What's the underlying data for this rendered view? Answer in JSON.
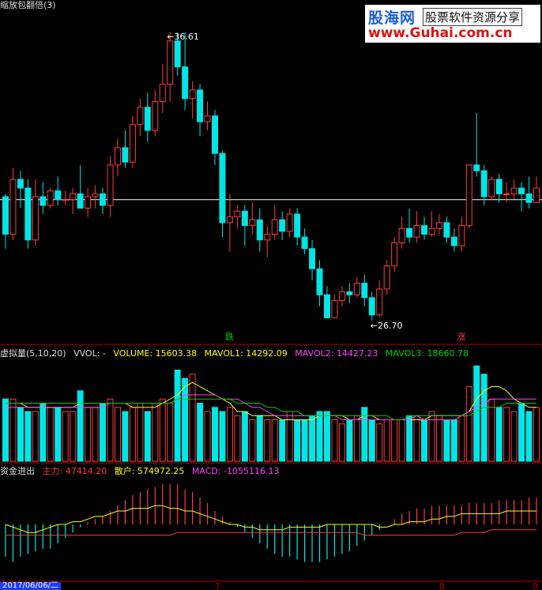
{
  "header": {
    "title": "缩放包翻倍(3)"
  },
  "logo": {
    "name": "股海网",
    "tagline": "股票软件资源分享",
    "url": "www.Guhai.com.cn"
  },
  "colors": {
    "up": "#ff3b3b",
    "down": "#00e5e5",
    "white": "#ffffff",
    "yellow": "#ffff00",
    "magenta": "#ff40ff",
    "green": "#00d000"
  },
  "price_panel": {
    "high_label": "36.61",
    "low_label": "26.70",
    "signals": [
      {
        "text": "跌",
        "color": "#00d000"
      },
      {
        "text": "涨",
        "color": "#ff3b3b"
      }
    ],
    "ref_price": 30.8
  },
  "volume_panel": {
    "name": "虚拟量(5,10,20)",
    "vvol": "VVOL: -",
    "volume": "VOLUME: 15603.38",
    "mavol1": "MAVOL1: 14292.09",
    "mavol2": "MAVOL2: 14427.23",
    "mavol3": "MAVOL3: 18660.78"
  },
  "fund_panel": {
    "name": "资金进出",
    "main": "主力: 47414.20",
    "retail": "散户: 574972.25",
    "macd": "MACD: -1055116.13"
  },
  "date_axis": {
    "first_date": "2017/06/06/二",
    "ticks": [
      "7",
      "8",
      "9"
    ]
  },
  "chart_data": {
    "type": "candlestick",
    "price_range": [
      26.0,
      37.5
    ],
    "candles": [
      [
        30.9,
        29.6,
        31.0,
        29.1
      ],
      [
        29.6,
        31.5,
        31.9,
        29.4
      ],
      [
        31.5,
        31.2,
        31.8,
        30.5
      ],
      [
        31.2,
        29.4,
        31.5,
        29.1
      ],
      [
        29.4,
        30.9,
        31.5,
        29.2
      ],
      [
        30.9,
        30.6,
        31.4,
        30.3
      ],
      [
        30.6,
        31.1,
        31.2,
        30.5
      ],
      [
        31.1,
        30.8,
        31.6,
        30.6
      ],
      [
        30.8,
        30.8,
        31.1,
        30.6
      ],
      [
        30.8,
        31.0,
        31.2,
        30.3
      ],
      [
        31.0,
        30.5,
        32.0,
        30.5
      ],
      [
        30.5,
        30.9,
        31.2,
        30.2
      ],
      [
        30.9,
        31.0,
        31.3,
        30.5
      ],
      [
        31.0,
        30.6,
        31.2,
        30.3
      ],
      [
        30.6,
        32.0,
        32.3,
        30.2
      ],
      [
        32.0,
        32.6,
        32.9,
        31.6
      ],
      [
        32.6,
        32.1,
        33.2,
        31.9
      ],
      [
        32.1,
        33.4,
        33.7,
        31.9
      ],
      [
        33.4,
        34.0,
        34.3,
        33.0
      ],
      [
        34.0,
        33.2,
        34.5,
        32.8
      ],
      [
        33.2,
        34.2,
        34.6,
        33.0
      ],
      [
        34.2,
        34.8,
        35.5,
        33.8
      ],
      [
        34.8,
        36.3,
        36.6,
        34.2
      ],
      [
        36.3,
        35.4,
        36.6,
        35.1
      ],
      [
        35.4,
        34.3,
        36.6,
        33.9
      ],
      [
        34.3,
        34.6,
        34.9,
        33.6
      ],
      [
        34.6,
        33.5,
        34.8,
        33.0
      ],
      [
        33.5,
        33.7,
        34.2,
        33.2
      ],
      [
        33.7,
        32.4,
        33.9,
        32.0
      ],
      [
        32.4,
        30.0,
        32.5,
        29.5
      ],
      [
        30.0,
        30.2,
        31.0,
        29.0
      ],
      [
        30.2,
        30.4,
        30.6,
        29.8
      ],
      [
        30.4,
        29.9,
        30.6,
        29.2
      ],
      [
        29.9,
        30.1,
        30.7,
        29.6
      ],
      [
        30.1,
        29.4,
        30.5,
        29.0
      ],
      [
        29.4,
        29.6,
        29.9,
        28.8
      ],
      [
        29.6,
        30.1,
        30.6,
        29.4
      ],
      [
        30.1,
        29.7,
        30.4,
        29.4
      ],
      [
        29.7,
        30.3,
        30.5,
        29.5
      ],
      [
        30.3,
        29.5,
        30.5,
        29.2
      ],
      [
        29.5,
        29.1,
        29.8,
        28.9
      ],
      [
        29.1,
        28.4,
        29.4,
        28.0
      ],
      [
        28.4,
        27.5,
        28.7,
        27.1
      ],
      [
        27.5,
        26.7,
        27.8,
        26.7
      ],
      [
        26.7,
        27.3,
        27.5,
        26.9
      ],
      [
        27.3,
        27.6,
        27.8,
        27.1
      ],
      [
        27.6,
        27.5,
        27.9,
        27.2
      ],
      [
        27.5,
        27.9,
        28.1,
        27.4
      ],
      [
        27.9,
        27.4,
        28.2,
        27.1
      ],
      [
        27.4,
        26.8,
        27.6,
        26.6
      ],
      [
        26.8,
        27.7,
        28.0,
        26.7
      ],
      [
        27.7,
        28.5,
        28.7,
        27.5
      ],
      [
        28.5,
        29.3,
        29.5,
        28.3
      ],
      [
        29.3,
        29.8,
        30.2,
        29.1
      ],
      [
        29.8,
        29.5,
        30.5,
        29.3
      ],
      [
        29.5,
        29.9,
        30.4,
        29.3
      ],
      [
        29.9,
        29.6,
        30.2,
        29.4
      ],
      [
        29.6,
        29.8,
        30.4,
        29.5
      ],
      [
        29.8,
        30.0,
        30.3,
        29.6
      ],
      [
        30.0,
        29.5,
        30.2,
        29.3
      ],
      [
        29.5,
        29.2,
        29.8,
        29.0
      ],
      [
        29.2,
        29.9,
        30.2,
        29.0
      ],
      [
        29.9,
        32.0,
        32.0,
        29.8
      ],
      [
        32.0,
        31.8,
        33.8,
        31.6
      ],
      [
        31.8,
        30.9,
        32.0,
        30.6
      ],
      [
        30.9,
        31.5,
        31.6,
        30.8
      ],
      [
        31.5,
        31.0,
        31.7,
        30.7
      ],
      [
        31.0,
        31.0,
        31.4,
        30.7
      ],
      [
        31.0,
        31.2,
        31.5,
        30.8
      ],
      [
        31.2,
        31.0,
        31.4,
        30.4
      ],
      [
        31.0,
        30.7,
        31.6,
        30.5
      ],
      [
        30.7,
        31.2,
        31.6,
        30.7
      ]
    ],
    "volumes": [
      15,
      15,
      13,
      12,
      12,
      14,
      13,
      13,
      12,
      12,
      17,
      13,
      13,
      14,
      15,
      13,
      12,
      13,
      14,
      12,
      14,
      15,
      14,
      22,
      20,
      21,
      14,
      12,
      13,
      12,
      13,
      11,
      12,
      10,
      11,
      10,
      10,
      10,
      12,
      10,
      10,
      11,
      12,
      12,
      10,
      9,
      10,
      11,
      13,
      10,
      9,
      10,
      10,
      10,
      11,
      11,
      10,
      12,
      11,
      10,
      10,
      11,
      18,
      23,
      21,
      15,
      13,
      13,
      12,
      14,
      12,
      13
    ],
    "mavol1": [
      14,
      14,
      14,
      13,
      13,
      13,
      13,
      13,
      13,
      13,
      14,
      14,
      14,
      14,
      14,
      14,
      14,
      13,
      13,
      13,
      13,
      14,
      15,
      16,
      18,
      19,
      18,
      17,
      16,
      15,
      14,
      12,
      12,
      11,
      11,
      11,
      11,
      10,
      10,
      10,
      10,
      10,
      11,
      11,
      11,
      11,
      10,
      10,
      11,
      11,
      10,
      10,
      10,
      10,
      10,
      10,
      10,
      11,
      11,
      11,
      11,
      11,
      12,
      15,
      17,
      18,
      18,
      17,
      15,
      14,
      13,
      13
    ],
    "mavol2": [
      13,
      13,
      13,
      13,
      13,
      13,
      13,
      13,
      13,
      13,
      13,
      13,
      13,
      13,
      14,
      14,
      14,
      14,
      14,
      14,
      14,
      14,
      14,
      15,
      16,
      16,
      16,
      16,
      16,
      15,
      15,
      15,
      14,
      13,
      13,
      12,
      11,
      11,
      11,
      11,
      11,
      11,
      11,
      11,
      11,
      10,
      10,
      10,
      10,
      10,
      10,
      10,
      10,
      10,
      10,
      11,
      10,
      10,
      10,
      10,
      10,
      11,
      12,
      13,
      14,
      15,
      15,
      15,
      15,
      15,
      15,
      15
    ],
    "mavol3": [
      14,
      14,
      14,
      14,
      14,
      14,
      14,
      14,
      14,
      14,
      14,
      14,
      14,
      14,
      14,
      14,
      14,
      14,
      14,
      14,
      14,
      14,
      14,
      15,
      15,
      15,
      15,
      15,
      15,
      15,
      15,
      14,
      14,
      14,
      14,
      13,
      13,
      12,
      12,
      12,
      11,
      11,
      11,
      11,
      11,
      11,
      11,
      11,
      11,
      11,
      11,
      11,
      10,
      10,
      11,
      11,
      11,
      11,
      11,
      11,
      11,
      11,
      11,
      12,
      13,
      13,
      13,
      14,
      14,
      14,
      14,
      14
    ],
    "macd_hist": [
      -12,
      -14,
      -12,
      -11,
      -10,
      -9,
      -9,
      -7,
      -5,
      -3,
      -1,
      1,
      2,
      3,
      5,
      7,
      9,
      11,
      12,
      13,
      14,
      15,
      15,
      15,
      13,
      12,
      10,
      8,
      5,
      3,
      1,
      -1,
      -3,
      -5,
      -7,
      -9,
      -11,
      -12,
      -12,
      -13,
      -14,
      -14,
      -14,
      -13,
      -12,
      -11,
      -10,
      -8,
      -6,
      -4,
      -2,
      0,
      2,
      4,
      5,
      6,
      6,
      7,
      7,
      7,
      7,
      7,
      8,
      8,
      8,
      8,
      9,
      9,
      9,
      9,
      10,
      10
    ],
    "main_line": [
      0,
      -1,
      -2,
      -3,
      -3,
      -2,
      -1,
      0,
      0,
      1,
      1,
      2,
      3,
      3,
      4,
      5,
      5,
      6,
      6,
      6,
      7,
      7,
      6,
      6,
      5,
      5,
      4,
      3,
      2,
      1,
      0,
      0,
      -1,
      -1,
      -2,
      -2,
      -2,
      -2,
      -1,
      -1,
      -1,
      -1,
      -1,
      0,
      0,
      0,
      0,
      0,
      0,
      0,
      -1,
      -1,
      0,
      0,
      1,
      1,
      1,
      2,
      2,
      3,
      3,
      4,
      4,
      4,
      4,
      4,
      4,
      5,
      5,
      5,
      5,
      5
    ],
    "retail_line": [
      -4,
      -4,
      -4,
      -4,
      -4,
      -4,
      -4,
      -4,
      -4,
      -4,
      -4,
      -4,
      -4,
      -4,
      -4,
      -4,
      -4,
      -4,
      -4,
      -4,
      -4,
      -4,
      -4,
      -3,
      -3,
      -3,
      -3,
      -3,
      -3,
      -3,
      -3,
      -3,
      -3,
      -3,
      -3,
      -3,
      -3,
      -3,
      -3,
      -3,
      -3,
      -3,
      -3,
      -3,
      -3,
      -3,
      -3,
      -3,
      -4,
      -4,
      -4,
      -4,
      -4,
      -4,
      -4,
      -4,
      -4,
      -4,
      -4,
      -4,
      -4,
      -3,
      -3,
      -3,
      -3,
      -2,
      -2,
      -2,
      -2,
      -2,
      -2,
      -2
    ]
  }
}
